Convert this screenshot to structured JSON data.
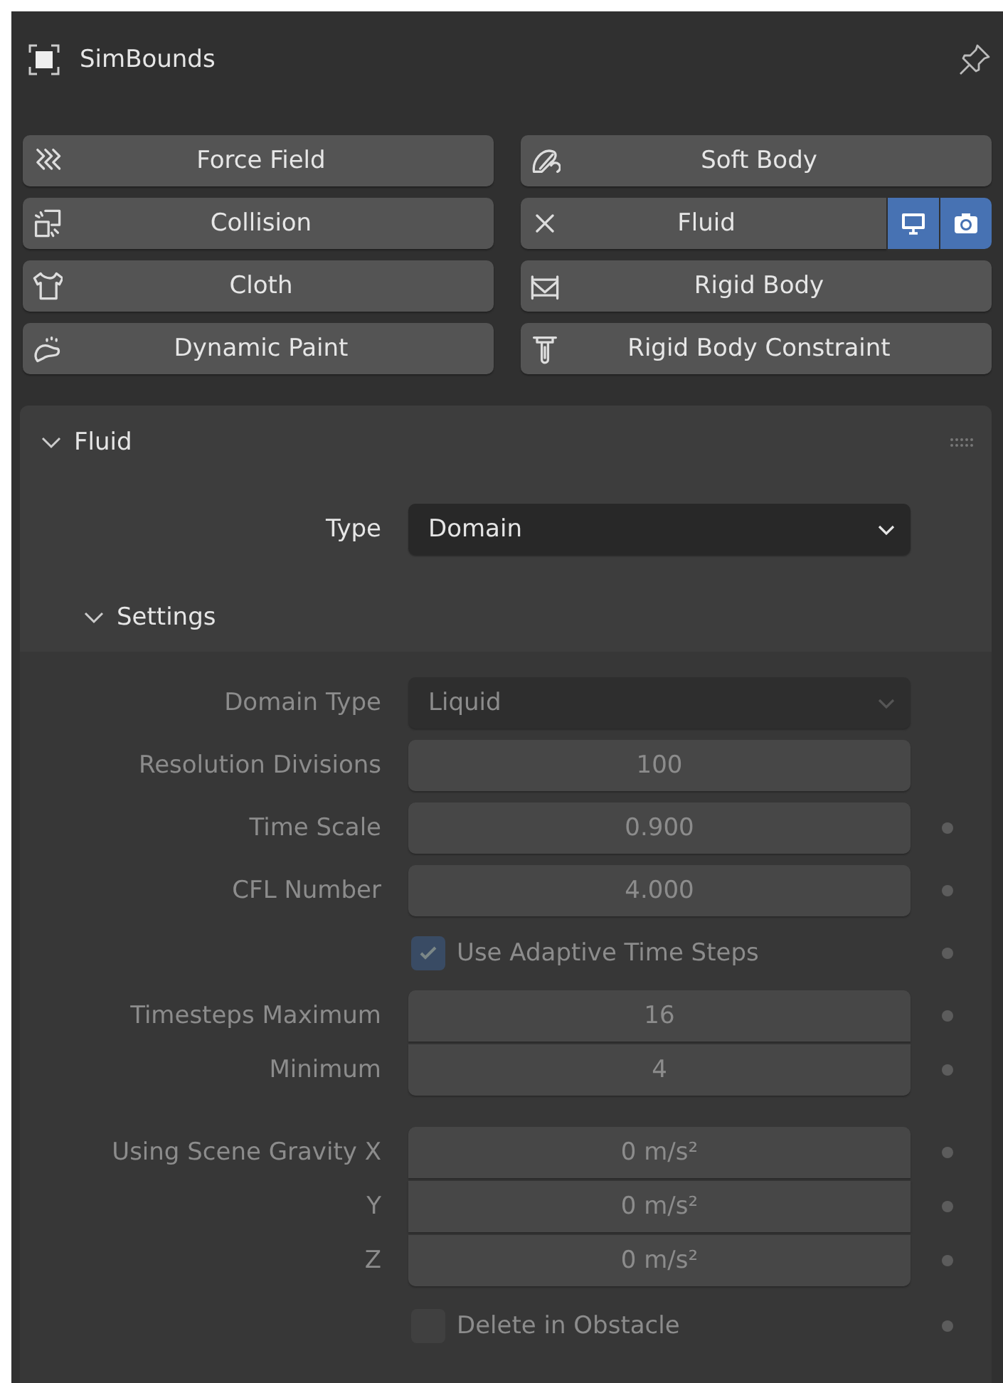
{
  "header": {
    "object_name": "SimBounds"
  },
  "physics_buttons": [
    {
      "label": "Force Field",
      "enabled": false
    },
    {
      "label": "Soft Body",
      "enabled": false
    },
    {
      "label": "Collision",
      "enabled": false
    },
    {
      "label": "Fluid",
      "enabled": true,
      "toggles": [
        {
          "kind": "viewport",
          "on": true
        },
        {
          "kind": "render",
          "on": true
        }
      ]
    },
    {
      "label": "Cloth",
      "enabled": false
    },
    {
      "label": "Rigid Body",
      "enabled": false
    },
    {
      "label": "Dynamic Paint",
      "enabled": false
    },
    {
      "label": "Rigid Body Constraint",
      "enabled": false
    }
  ],
  "fluid_panel": {
    "title": "Fluid",
    "expanded": true,
    "type_row": {
      "label": "Type",
      "value": "Domain",
      "kind": "dropdown",
      "disabled": false
    },
    "settings": {
      "title": "Settings",
      "expanded": true,
      "groups": [
        [
          {
            "kind": "dropdown",
            "label": "Domain Type",
            "value": "Liquid",
            "disabled": true
          },
          {
            "kind": "number",
            "label": "Resolution Divisions",
            "value": "100",
            "disabled": true
          },
          {
            "kind": "number",
            "label": "Time Scale",
            "value": "0.900",
            "disabled": true,
            "keyframe_dot": true
          },
          {
            "kind": "number",
            "label": "CFL Number",
            "value": "4.000",
            "disabled": true,
            "keyframe_dot": true
          },
          {
            "kind": "checkbox",
            "label": "Use Adaptive Time Steps",
            "checked": true,
            "disabled": true,
            "keyframe_dot": true
          },
          {
            "kind": "number",
            "label": "Timesteps Maximum",
            "value": "16",
            "disabled": true,
            "keyframe_dot": true
          },
          {
            "kind": "number",
            "label": "Minimum",
            "value": "4",
            "disabled": true,
            "keyframe_dot": true,
            "joined": true
          }
        ],
        [
          {
            "kind": "number",
            "label": "Using Scene Gravity X",
            "value": "0 m/s²",
            "disabled": true,
            "keyframe_dot": true
          },
          {
            "kind": "number",
            "label": "Y",
            "value": "0 m/s²",
            "disabled": true,
            "keyframe_dot": true,
            "joined": true
          },
          {
            "kind": "number",
            "label": "Z",
            "value": "0 m/s²",
            "disabled": true,
            "keyframe_dot": true,
            "joined": true
          },
          {
            "kind": "checkbox",
            "label": "Delete in Obstacle",
            "checked": false,
            "disabled": true,
            "keyframe_dot": true
          }
        ]
      ]
    }
  }
}
